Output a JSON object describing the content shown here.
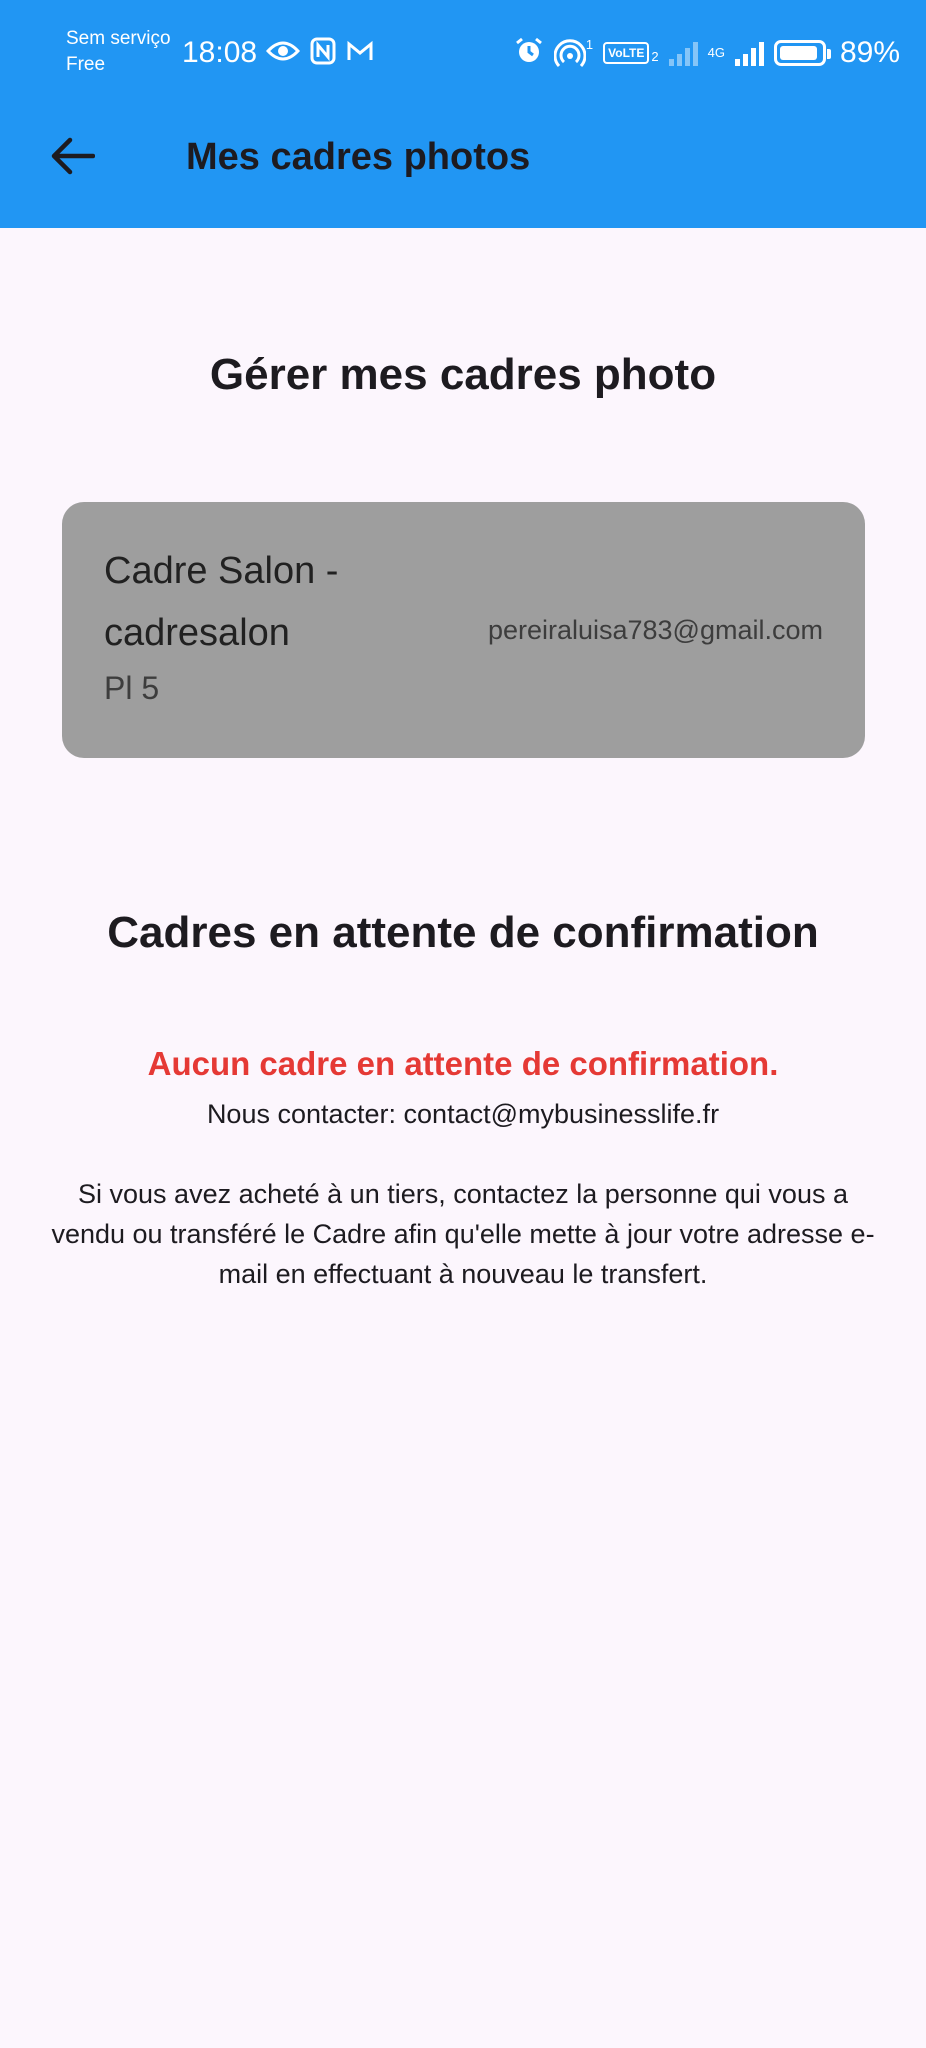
{
  "status_bar": {
    "carrier_line1": "Sem serviço",
    "carrier_line2": "Free",
    "time": "18:08",
    "battery_percent": "89%",
    "sim_slot": "1",
    "volte_label": "VoLTE",
    "volte_slot": "2",
    "network_label": "4G"
  },
  "app_bar": {
    "title": "Mes cadres photos",
    "background_color": "#2196f3"
  },
  "manage_section": {
    "heading": "Gérer mes cadres photo",
    "frames": [
      {
        "name": "Cadre Salon - cadresalon",
        "subtitle": "Pl 5",
        "email": "pereiraluisa783@gmail.com"
      }
    ]
  },
  "pending_section": {
    "heading": "Cadres en attente de confirmation",
    "empty_message": "Aucun cadre en attente de confirmation.",
    "contact_text": "Nous contacter: contact@mybusinesslife.fr",
    "info_text": "Si vous avez acheté à un tiers, contactez la personne qui vous a vendu ou transféré le Cadre afin qu'elle mette à jour votre adresse e-mail en effectuant à nouveau le transfert.",
    "empty_message_color": "#e53935"
  }
}
